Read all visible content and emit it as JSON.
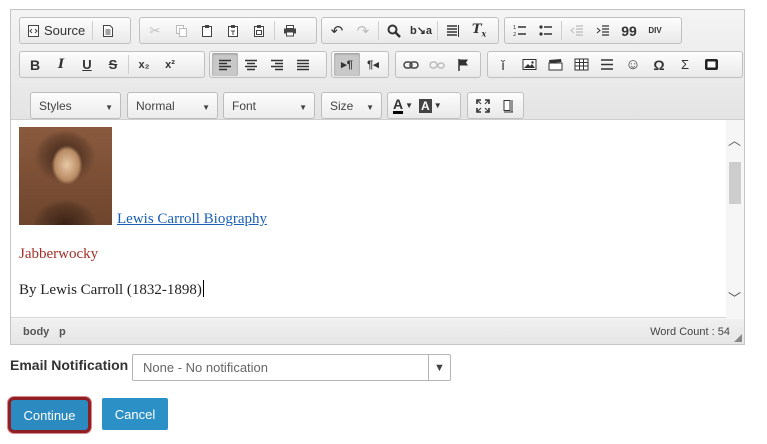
{
  "toolbar": {
    "source_label": "Source",
    "icons": {
      "source": "source-icon",
      "templates": "templates-icon",
      "cut": "cut-icon",
      "copy": "copy-icon",
      "paste": "paste-icon",
      "paste_text": "paste-text-icon",
      "paste_word": "paste-word-icon",
      "print": "print-icon",
      "undo": "undo-icon",
      "redo": "redo-icon",
      "find": "find-icon",
      "replace": "replace-icon",
      "select_all": "select-all-icon",
      "remove_format": "remove-format-icon",
      "numbered_list": "numbered-list-icon",
      "bulleted_list": "bulleted-list-icon",
      "outdent": "outdent-icon",
      "indent": "indent-icon",
      "blockquote": "blockquote-icon",
      "div": "create-div-icon",
      "bold": "bold-icon",
      "italic": "italic-icon",
      "underline": "underline-icon",
      "strike": "strikethrough-icon",
      "subscript": "subscript-icon",
      "superscript": "superscript-icon",
      "align_left": "align-left-icon",
      "align_center": "align-center-icon",
      "align_right": "align-right-icon",
      "justify": "justify-icon",
      "ltr": "text-direction-ltr-icon",
      "rtl": "text-direction-rtl-icon",
      "link": "link-icon",
      "unlink": "unlink-icon",
      "anchor": "anchor-flag-icon",
      "audio": "audio-icon",
      "image": "image-icon",
      "movie": "movie-icon",
      "table": "table-icon",
      "hr": "horizontal-line-icon",
      "smiley": "smiley-icon",
      "special_char": "special-character-icon",
      "math": "math-sigma-icon",
      "media": "media-icon",
      "text_color": "text-color-icon",
      "bg_color": "background-color-icon",
      "maximize": "maximize-icon",
      "show_blocks": "show-blocks-icon"
    },
    "glyphs": {
      "subscript": "x₂",
      "superscript": "x²",
      "bold": "B",
      "italic": "I",
      "underline": "U",
      "strike": "S",
      "blockquote": "99",
      "div": "DIV",
      "omega": "Ω",
      "sigma": "Σ",
      "text_color": "A",
      "bg_color": "A"
    },
    "styles_label": "Styles",
    "format_label": "Normal",
    "font_label": "Font",
    "size_label": "Size"
  },
  "content": {
    "link_text": "Lewis Carroll Biography",
    "poem_title": "Jabberwocky",
    "author_line": "By Lewis Carroll (1832-1898)"
  },
  "statusbar": {
    "path": [
      "body",
      "p"
    ],
    "word_count": "Word Count : 54"
  },
  "form": {
    "email_label": "Email Notification",
    "email_value": "None - No notification",
    "continue_label": "Continue",
    "cancel_label": "Cancel"
  },
  "colors": {
    "link": "#1a5fb4",
    "poem_title": "#a4302a",
    "button_blue": "#2b8ac0",
    "focus_ring": "#8d1f25"
  }
}
